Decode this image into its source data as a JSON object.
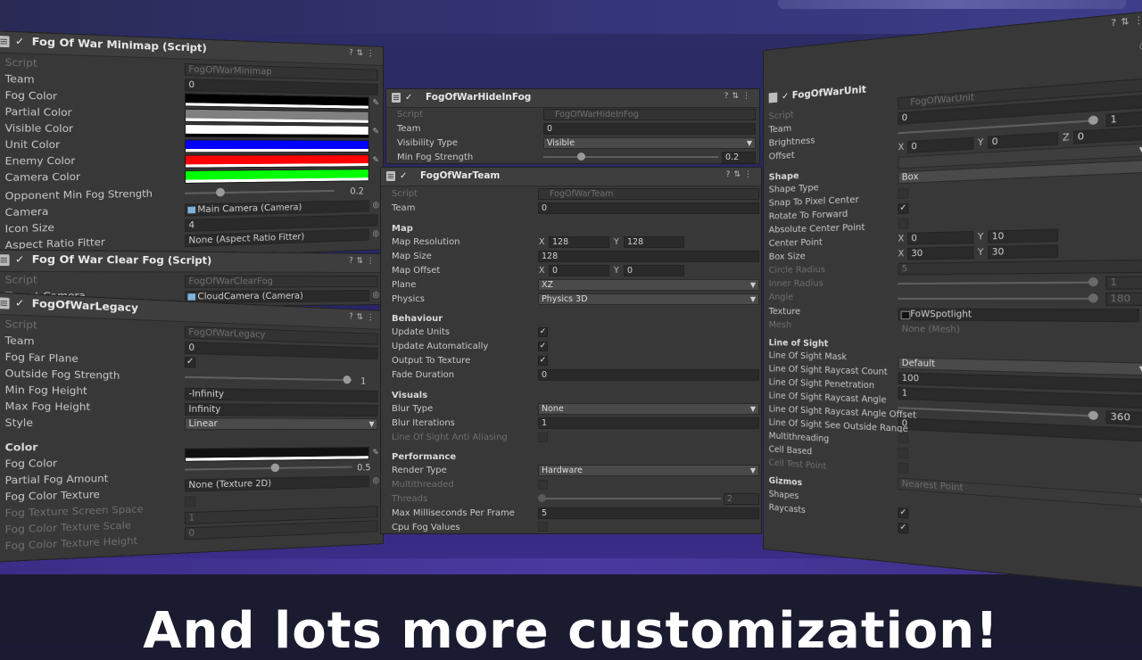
{
  "caption": "And lots more customization!",
  "minimap": {
    "title": "Fog Of War Minimap (Script)",
    "rows": {
      "script": "Script",
      "team": "Team",
      "fog_color": "Fog Color",
      "partial_color": "Partial Color",
      "visible_color": "Visible Color",
      "unit_color": "Unit Color",
      "enemy_color": "Enemy Color",
      "camera_color": "Camera Color",
      "opponent_min_fog": "Opponent Min Fog Strength",
      "camera": "Camera",
      "icon_size": "Icon Size",
      "aspect_ratio": "Aspect Ratio Fitter"
    },
    "values": {
      "script": "FogOfWarMinimap",
      "team": "0",
      "opponent_min_fog": "0.2",
      "camera": "Main Camera (Camera)",
      "icon_size": "4",
      "aspect_ratio": "None (Aspect Ratio Fitter)"
    },
    "colors": {
      "fog": "#000000",
      "partial": "#808080",
      "visible": "#ffffff",
      "unit": "#0000ff",
      "enemy": "#ff0000",
      "camera": "#00ff00"
    }
  },
  "clearfog": {
    "title": "Fog Of War Clear Fog (Script)",
    "rows": {
      "script": "Script",
      "target_camera": "Target Camera"
    },
    "values": {
      "script": "FogOfWarClearFog",
      "target_camera": "CloudCamera (Camera)"
    }
  },
  "legacy": {
    "title": "FogOfWarLegacy",
    "rows": {
      "script": "Script",
      "team": "Team",
      "fog_far_plane": "Fog Far Plane",
      "outside_fog": "Outside Fog Strength",
      "min_fog_height": "Min Fog Height",
      "max_fog_height": "Max Fog Height",
      "style": "Style",
      "color_section": "Color",
      "fog_color": "Fog Color",
      "partial_fog_amount": "Partial Fog Amount",
      "fog_color_texture": "Fog Color Texture",
      "tex_screen_space": "Fog Texture Screen Space",
      "tex_scale": "Fog Color Texture Scale",
      "tex_height": "Fog Color Texture Height"
    },
    "values": {
      "script": "FogOfWarLegacy",
      "team": "0",
      "outside_fog": "1",
      "min_fog_height": "-Infinity",
      "max_fog_height": "Infinity",
      "style": "Linear",
      "partial_fog_amount": "0.5",
      "fog_color_texture": "None (Texture 2D)",
      "tex_scale": "1",
      "tex_height": "0"
    }
  },
  "hideinfog": {
    "title": "FogOfWarHideInFog",
    "rows": {
      "script": "Script",
      "team": "Team",
      "visibility_type": "Visibility Type",
      "min_fog_strength": "Min Fog Strength"
    },
    "values": {
      "script": "FogOfWarHideInFog",
      "team": "0",
      "visibility_type": "Visible",
      "min_fog_strength": "0.2"
    }
  },
  "team": {
    "title": "FogOfWarTeam",
    "rows": {
      "script": "Script",
      "team": "Team",
      "map_section": "Map",
      "map_resolution": "Map Resolution",
      "map_size": "Map Size",
      "map_offset": "Map Offset",
      "plane": "Plane",
      "physics": "Physics",
      "behaviour_section": "Behaviour",
      "update_units": "Update Units",
      "update_auto": "Update Automatically",
      "output_texture": "Output To Texture",
      "fade_duration": "Fade Duration",
      "visuals_section": "Visuals",
      "blur_type": "Blur Type",
      "blur_iterations": "Blur Iterations",
      "los_aa": "Line Of Sight Anti Aliasing",
      "performance_section": "Performance",
      "render_type": "Render Type",
      "multithreaded": "Multithreaded",
      "threads": "Threads",
      "max_ms": "Max Milliseconds Per Frame",
      "cpu_fog": "Cpu Fog Values"
    },
    "values": {
      "script": "FogOfWarTeam",
      "team": "0",
      "map_res_x": "128",
      "map_res_y": "128",
      "map_size": "128",
      "map_off_x": "0",
      "map_off_y": "0",
      "plane": "XZ",
      "physics": "Physics 3D",
      "fade_duration": "0",
      "blur_type": "None",
      "blur_iterations": "1",
      "render_type": "Hardware",
      "threads": "2",
      "max_ms": "5"
    },
    "axis": {
      "x": "X",
      "y": "Y"
    }
  },
  "unit": {
    "title": "FogOfWarUnit",
    "rows": {
      "script": "Script",
      "team": "Team",
      "brightness": "Brightness",
      "offset": "Offset",
      "shape_section": "Shape",
      "shape_type": "Shape Type",
      "snap_pixel": "Snap To Pixel Center",
      "rotate_forward": "Rotate To Forward",
      "abs_center": "Absolute Center Point",
      "center_point": "Center Point",
      "box_size": "Box Size",
      "circle_radius": "Circle Radius",
      "inner_radius": "Inner Radius",
      "angle": "Angle",
      "texture": "Texture",
      "mesh": "Mesh",
      "los_section": "Line of Sight",
      "los_mask": "Line Of Sight Mask",
      "los_raycast_count": "Line Of Sight Raycast Count",
      "los_penetration": "Line Of Sight Penetration",
      "los_raycast_angle": "Line Of Sight Raycast Angle",
      "los_raycast_offset": "Line Of Sight Raycast Angle Offset",
      "los_see_outside": "Line Of Sight See Outside Range",
      "multithreading": "Multithreading",
      "cell_based": "Cell Based",
      "cell_test_point": "Cell Test Point",
      "gizmos_section": "Gizmos",
      "shapes": "Shapes",
      "raycasts": "Raycasts"
    },
    "values": {
      "script": "FogOfWarUnit",
      "team": "0",
      "brightness": "1",
      "off_x": "0",
      "off_y": "0",
      "off_z": "0",
      "shape_type": "Box",
      "center_x": "0",
      "center_y": "10",
      "box_x": "30",
      "box_y": "30",
      "circle_radius": "5",
      "inner_radius": "1",
      "angle": "180",
      "texture": "FoWSpotlight",
      "mesh": "None (Mesh)",
      "los_mask": "Default",
      "los_raycast_count": "100",
      "los_penetration": "1",
      "los_raycast_angle": "360",
      "los_raycast_offset": "0",
      "cell_test_point": "Nearest Point"
    },
    "axis": {
      "x": "X",
      "y": "Y",
      "z": "Z"
    }
  }
}
